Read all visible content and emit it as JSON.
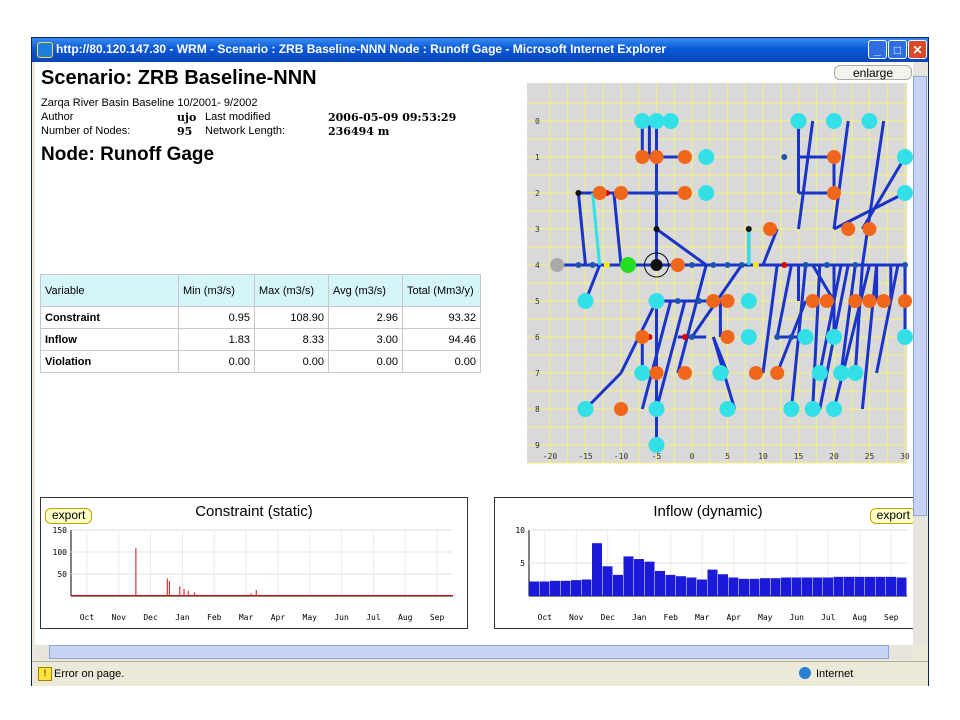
{
  "window": {
    "title": "http://80.120.147.30 - WRM - Scenario : ZRB Baseline-NNN Node : Runoff Gage - Microsoft Internet Explorer",
    "minimize": "_",
    "maximize": "□",
    "close": "✕"
  },
  "status": {
    "text": "Error on page.",
    "zone": "Internet",
    "icon": "warning-icon"
  },
  "scenario": {
    "title": "Scenario: ZRB Baseline-NNN",
    "subtitle": "Zarqa River Basin Baseline 10/2001- 9/2002",
    "author_label": "Author",
    "author": "ujo",
    "modified_label": "Last modified",
    "modified": "2006-05-09 09:53:29",
    "nodes_label": "Number of Nodes:",
    "nodes": "95",
    "length_label": "Network Length:",
    "length": "236494 m"
  },
  "node": {
    "title": "Node: Runoff Gage"
  },
  "table": {
    "headers": [
      "Variable",
      "Min (m3/s)",
      "Max (m3/s)",
      "Avg (m3/s)",
      "Total (Mm3/y)"
    ],
    "rows": [
      [
        "Constraint",
        "0.95",
        "108.90",
        "2.96",
        "93.32"
      ],
      [
        "Inflow",
        "1.83",
        "8.33",
        "3.00",
        "94.46"
      ],
      [
        "Violation",
        "0.00",
        "0.00",
        "0.00",
        "0.00"
      ]
    ]
  },
  "map": {
    "enlarge": "enlarge",
    "x_ticks": [
      "-20",
      "-15",
      "-10",
      "-5",
      "0",
      "5",
      "10",
      "15",
      "20",
      "25",
      "30"
    ],
    "y_ticks": [
      "0",
      "1",
      "2",
      "3",
      "4",
      "5",
      "6",
      "7",
      "8",
      "9"
    ],
    "colors": {
      "background": "#d9d9d9",
      "grid": "#f2f27a",
      "link": "#1a33c8",
      "demand": "#33e0e8",
      "supply": "#f0661a"
    }
  },
  "chart_data": [
    {
      "type": "bar",
      "title": "Constraint (static)",
      "export": "export",
      "categories": [
        "Oct",
        "Nov",
        "Dec",
        "Jan",
        "Feb",
        "Mar",
        "Apr",
        "May",
        "Jun",
        "Jul",
        "Aug",
        "Sep"
      ],
      "y_ticks": [
        "150",
        "100",
        "50"
      ],
      "ylim": [
        0,
        150
      ],
      "color": "#cc1111",
      "spikes": [
        {
          "day": 62,
          "value": 108.9
        },
        {
          "day": 92,
          "value": 40
        },
        {
          "day": 94,
          "value": 34
        },
        {
          "day": 104,
          "value": 22
        },
        {
          "day": 108,
          "value": 16
        },
        {
          "day": 112,
          "value": 12
        },
        {
          "day": 118,
          "value": 8
        },
        {
          "day": 172,
          "value": 6
        },
        {
          "day": 177,
          "value": 14
        }
      ],
      "baseline": 0.95
    },
    {
      "type": "area",
      "title": "Inflow (dynamic)",
      "export": "export",
      "categories": [
        "Oct",
        "Nov",
        "Dec",
        "Jan",
        "Feb",
        "Mar",
        "Apr",
        "May",
        "Jun",
        "Jul",
        "Aug",
        "Sep"
      ],
      "y_ticks": [
        "10",
        "5"
      ],
      "ylim": [
        0,
        10
      ],
      "color": "#1a1ad8",
      "values": [
        2.2,
        2.2,
        2.3,
        2.3,
        2.4,
        2.5,
        8.0,
        4.5,
        3.2,
        6.0,
        5.6,
        5.2,
        3.8,
        3.2,
        3.0,
        2.8,
        2.5,
        4.0,
        3.3,
        2.8,
        2.6,
        2.6,
        2.7,
        2.7,
        2.8,
        2.8,
        2.8,
        2.8,
        2.8,
        2.9,
        2.9,
        2.9,
        2.9,
        2.9,
        2.9,
        2.8
      ]
    }
  ]
}
